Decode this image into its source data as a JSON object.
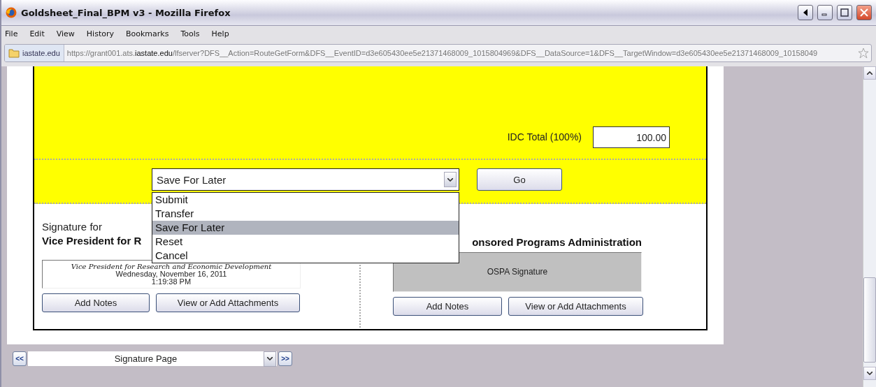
{
  "window": {
    "title": "Goldsheet_Final_BPM v3 - Mozilla Firefox"
  },
  "menu": [
    {
      "label": "File"
    },
    {
      "label": "Edit"
    },
    {
      "label": "View"
    },
    {
      "label": "History"
    },
    {
      "label": "Bookmarks"
    },
    {
      "label": "Tools"
    },
    {
      "label": "Help"
    }
  ],
  "address_bar": {
    "site": "iastate.edu",
    "url": "https://grant001.ats.**iastate.edu**/lfserver?DFS__Action=RouteGetForm&DFS__EventID=d3e605430ee5e21371468009_1015804969&DFS__DataSource=1&DFS__TargetWindow=d3e605430ee5e21371468009_10158049"
  },
  "form": {
    "idc_label": "IDC Total (100%)",
    "idc_value": "100.00",
    "action_select": {
      "value": "Save For Later",
      "expanded": true,
      "options": [
        {
          "label": "Submit",
          "selected": false
        },
        {
          "label": "Transfer",
          "selected": false
        },
        {
          "label": "Save For Later",
          "selected": true
        },
        {
          "label": "Reset",
          "selected": false
        },
        {
          "label": "Cancel",
          "selected": false
        }
      ]
    },
    "go_button": "Go",
    "signatures": [
      {
        "heading": "Signature for",
        "title": "Vice President for R",
        "signed": true,
        "signature_text": "Vice President for Research and Economic Development",
        "date": "Wednesday, November 16, 2011",
        "time": "1:19:38 PM",
        "buttons": [
          "Add Notes",
          "View or Add Attachments"
        ]
      },
      {
        "title": "onsored Programs Administration",
        "signed": false,
        "placeholder": "OSPA Signature",
        "buttons": [
          "Add Notes",
          "View or Add Attachments"
        ]
      }
    ]
  },
  "page_nav": {
    "prev": "<<",
    "page": "Signature Page",
    "next": ">>"
  }
}
